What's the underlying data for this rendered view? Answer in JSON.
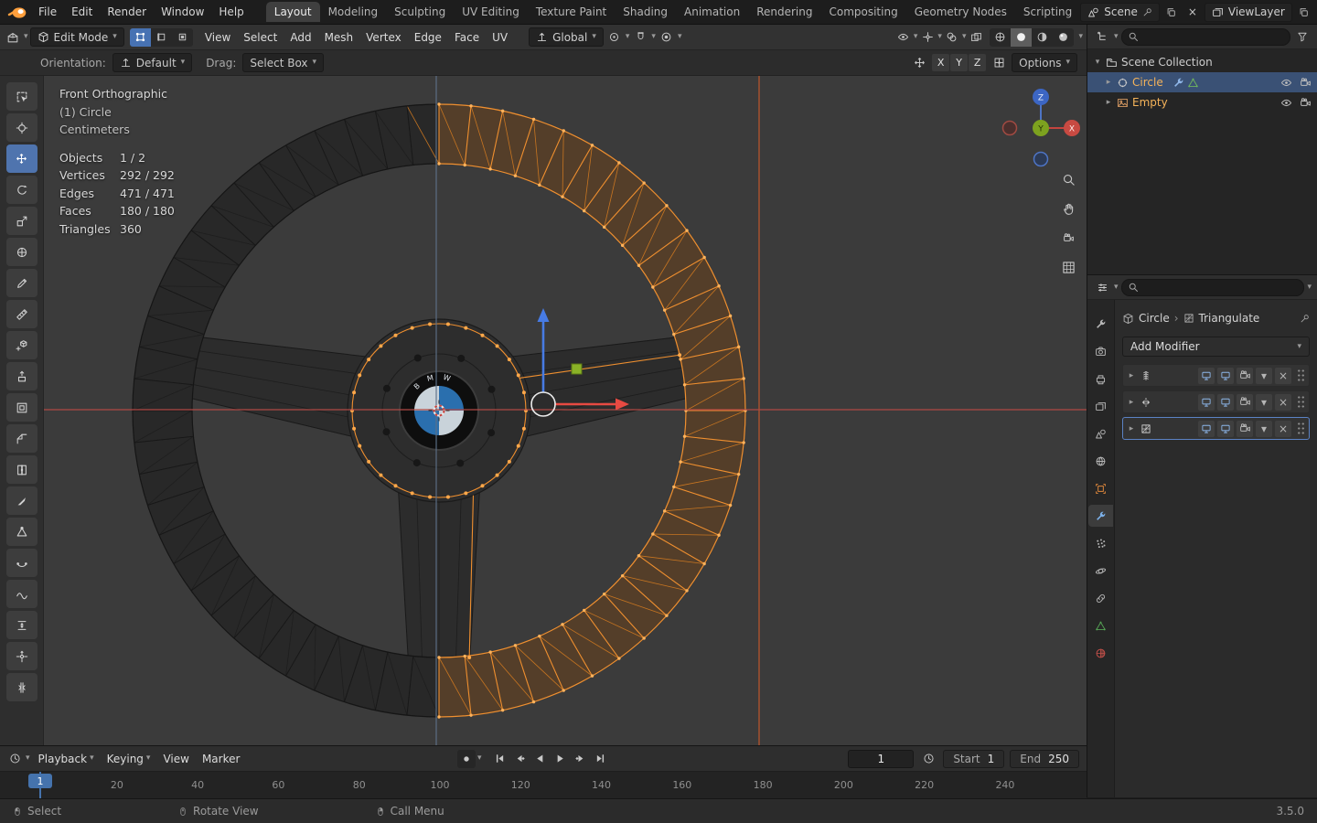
{
  "colors": {
    "accent_blue": "#4772b3",
    "selection_orange": "#ef8f2f",
    "active_object_orange": "#f5b35a",
    "axis_x_red": "#b04844",
    "axis_z_blue": "#5c7088",
    "viewport_bg": "#3b3b3b"
  },
  "topbar": {
    "menus": [
      {
        "label": "File"
      },
      {
        "label": "Edit"
      },
      {
        "label": "Render"
      },
      {
        "label": "Window"
      },
      {
        "label": "Help"
      }
    ],
    "tabs": [
      {
        "label": "Layout",
        "active": true
      },
      {
        "label": "Modeling"
      },
      {
        "label": "Sculpting"
      },
      {
        "label": "UV Editing"
      },
      {
        "label": "Texture Paint"
      },
      {
        "label": "Shading"
      },
      {
        "label": "Animation"
      },
      {
        "label": "Rendering"
      },
      {
        "label": "Compositing"
      },
      {
        "label": "Geometry Nodes"
      },
      {
        "label": "Scripting"
      }
    ],
    "scene_label": "Scene",
    "viewlayer_label": "ViewLayer"
  },
  "header": {
    "mode": "Edit Mode",
    "menus": [
      {
        "label": "View"
      },
      {
        "label": "Select"
      },
      {
        "label": "Add"
      },
      {
        "label": "Mesh"
      },
      {
        "label": "Vertex"
      },
      {
        "label": "Edge"
      },
      {
        "label": "Face"
      },
      {
        "label": "UV"
      }
    ],
    "orientation": "Global"
  },
  "tool_settings": {
    "orientation_label": "Orientation:",
    "orientation_value": "Default",
    "drag_label": "Drag:",
    "drag_value": "Select Box",
    "axes": [
      {
        "label": "X"
      },
      {
        "label": "Y"
      },
      {
        "label": "Z"
      }
    ],
    "options_label": "Options"
  },
  "toolbar": {
    "tools": [
      {
        "name": "tool-select-box"
      },
      {
        "name": "tool-cursor"
      },
      {
        "name": "tool-move",
        "active": true
      },
      {
        "name": "tool-rotate"
      },
      {
        "name": "tool-scale"
      },
      {
        "name": "tool-transform"
      },
      {
        "name": "tool-annotate"
      },
      {
        "name": "tool-measure"
      },
      {
        "name": "tool-add-cube"
      },
      {
        "name": "tool-extrude"
      },
      {
        "name": "tool-inset"
      },
      {
        "name": "tool-bevel"
      },
      {
        "name": "tool-loopcut"
      },
      {
        "name": "tool-knife"
      },
      {
        "name": "tool-polybuild"
      },
      {
        "name": "tool-spin"
      },
      {
        "name": "tool-smooth"
      },
      {
        "name": "tool-edge-slide"
      },
      {
        "name": "tool-shrink"
      },
      {
        "name": "tool-rip"
      }
    ]
  },
  "viewport": {
    "view_label": "Front Orthographic",
    "object_label": "(1) Circle",
    "units_label": "Centimeters",
    "stats": [
      {
        "label": "Objects",
        "value": "1 / 2"
      },
      {
        "label": "Vertices",
        "value": "292 / 292"
      },
      {
        "label": "Edges",
        "value": "471 / 471"
      },
      {
        "label": "Faces",
        "value": "180 / 180"
      },
      {
        "label": "Triangles",
        "value": "360"
      }
    ],
    "axis_labels": {
      "x": "X",
      "y": "Y",
      "z": "Z"
    },
    "hub_text": "BMW"
  },
  "outliner": {
    "title": "Scene Collection",
    "items": [
      {
        "name": "Circle",
        "selected": true,
        "icon": "mesh-circle"
      },
      {
        "name": "Empty",
        "icon": "empty-image"
      }
    ]
  },
  "properties": {
    "tabs": [
      {
        "name": "ptab-tool"
      },
      {
        "name": "ptab-render"
      },
      {
        "name": "ptab-output"
      },
      {
        "name": "ptab-viewlayer"
      },
      {
        "name": "ptab-scene"
      },
      {
        "name": "ptab-world"
      },
      {
        "name": "ptab-object",
        "tint": "#e0883c"
      },
      {
        "name": "ptab-modifiers",
        "active": true,
        "tint": "#7cb0e8"
      },
      {
        "name": "ptab-particles"
      },
      {
        "name": "ptab-physics"
      },
      {
        "name": "ptab-constraints"
      },
      {
        "name": "ptab-data",
        "tint": "#55a154"
      },
      {
        "name": "ptab-material",
        "tint": "#c4504a"
      }
    ],
    "breadcrumb_object": "Circle",
    "breadcrumb_modifier": "Triangulate",
    "add_modifier_label": "Add Modifier",
    "modifiers": [
      {
        "name": "mod-screw"
      },
      {
        "name": "mod-mirror"
      },
      {
        "name": "mod-triangulate",
        "active": true
      }
    ]
  },
  "timeline": {
    "menus": [
      {
        "label": "Playback",
        "caret": true
      },
      {
        "label": "Keying",
        "caret": true
      },
      {
        "label": "View"
      },
      {
        "label": "Marker"
      }
    ],
    "frame_field": "1",
    "start_label": "Start",
    "start_value": "1",
    "end_label": "End",
    "end_value": "250",
    "current_frame": "1",
    "ruler": [
      20,
      40,
      60,
      80,
      100,
      120,
      140,
      160,
      180,
      200,
      220,
      240
    ]
  },
  "statusbar": {
    "hints": [
      {
        "label": "Select",
        "icon": "mouse-left"
      },
      {
        "label": "Rotate View",
        "icon": "mouse-middle"
      },
      {
        "label": "Call Menu",
        "icon": "mouse-right"
      }
    ],
    "version": "3.5.0"
  }
}
